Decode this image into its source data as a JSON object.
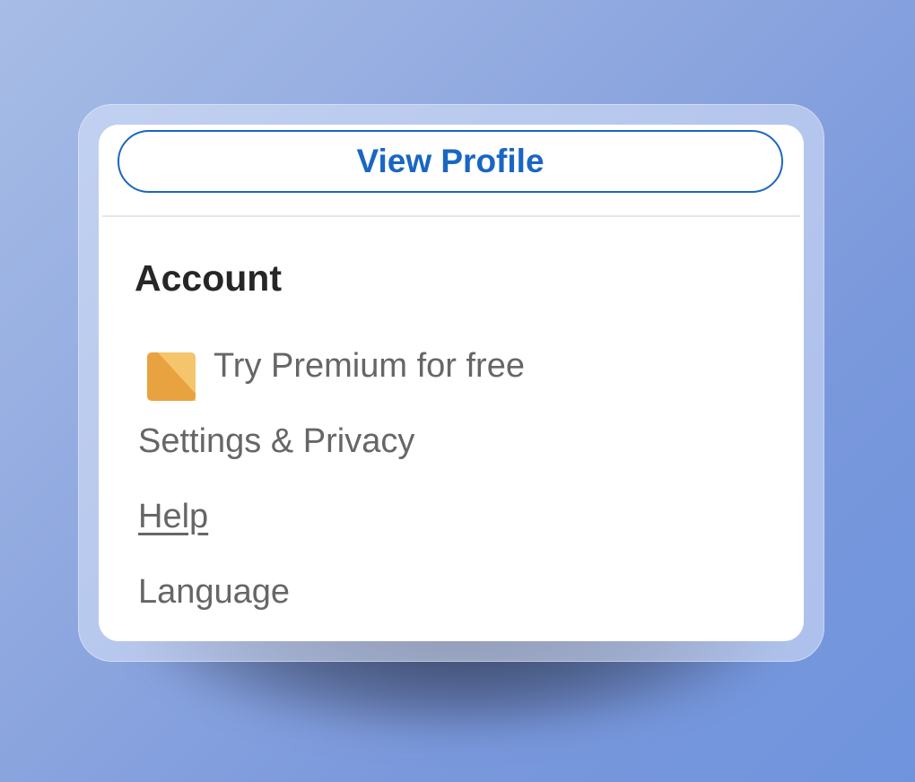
{
  "profile_menu": {
    "view_profile_label": "View Profile",
    "account_section": {
      "title": "Account",
      "items": [
        {
          "label": "Try Premium for free",
          "icon": "premium-icon"
        },
        {
          "label": "Settings & Privacy"
        },
        {
          "label": "Help"
        },
        {
          "label": "Language"
        }
      ]
    }
  },
  "colors": {
    "accent": "#1a66c2",
    "premium_icon_light": "#f5c56e",
    "premium_icon_dark": "#e8a23f",
    "muted_text": "#666666",
    "heading_text": "#262626"
  }
}
